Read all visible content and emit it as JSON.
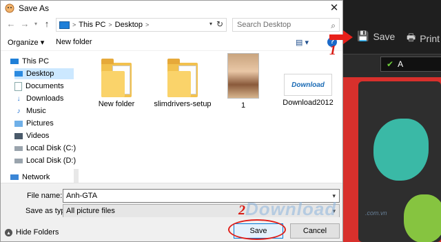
{
  "dialog": {
    "title": "Save As",
    "close_glyph": "✕",
    "nav": {
      "back": "←",
      "forward": "→",
      "up": "↑"
    },
    "address": {
      "root": "This PC",
      "sep1": ">",
      "folder": "Desktop",
      "sep2": ">"
    },
    "search": {
      "placeholder": "Search Desktop"
    },
    "toolbar": {
      "organize_label": "Organize ▾",
      "new_folder_label": "New folder",
      "view_label": "▤ ▾",
      "help_label": "?"
    },
    "nav_pane": {
      "items": [
        {
          "label": "This PC",
          "icon": "computer-icon"
        },
        {
          "label": "Desktop",
          "icon": "desktop-icon",
          "selected": true
        },
        {
          "label": "Documents",
          "icon": "documents-icon"
        },
        {
          "label": "Downloads",
          "icon": "downloads-icon"
        },
        {
          "label": "Music",
          "icon": "music-icon"
        },
        {
          "label": "Pictures",
          "icon": "pictures-icon"
        },
        {
          "label": "Videos",
          "icon": "videos-icon"
        },
        {
          "label": "Local Disk (C:)",
          "icon": "drive-icon"
        },
        {
          "label": "Local Disk (D:)",
          "icon": "drive-icon"
        },
        {
          "label": "Network",
          "icon": "network-icon"
        }
      ]
    },
    "files": [
      {
        "name": "New folder",
        "kind": "folder"
      },
      {
        "name": "slimdrivers-setup",
        "kind": "folder"
      },
      {
        "name": "1",
        "kind": "image"
      },
      {
        "name": "Download2012",
        "kind": "image",
        "thumb_text": "Download"
      }
    ],
    "file_name": {
      "label": "File name:",
      "value": "Anh-GTA"
    },
    "save_as_type": {
      "label": "Save as type:",
      "value": "All picture files"
    },
    "footer": {
      "hide_folders_label": "Hide Folders",
      "save_label": "Save",
      "cancel_label": "Cancel"
    }
  },
  "background_app": {
    "save_label": "Save",
    "print_label": "Print",
    "check_label": "A"
  },
  "annotations": {
    "step_one": "1",
    "step_two": "2",
    "watermark": "Download",
    "watermark_domain": ".com.vn"
  },
  "colors": {
    "accent": "#0078d7",
    "selection": "#cce8ff",
    "annotation_red": "#d81b14"
  }
}
